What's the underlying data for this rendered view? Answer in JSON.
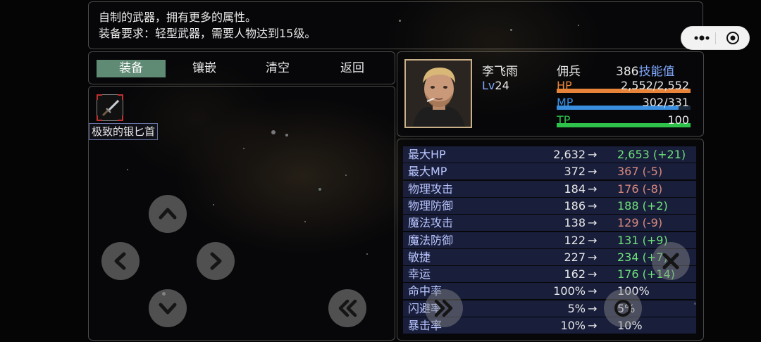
{
  "item_description": {
    "line1": "自制的武器，拥有更多的属性。",
    "line2": "装备要求：轻型武器，需要人物达到15级。"
  },
  "tabs": [
    {
      "label": "装备",
      "active": true
    },
    {
      "label": "镶嵌",
      "active": false
    },
    {
      "label": "清空",
      "active": false
    },
    {
      "label": "返回",
      "active": false
    }
  ],
  "inventory": {
    "selected_item": {
      "name": "极致的银匕首",
      "icon": "dagger-icon"
    }
  },
  "character": {
    "name": "李飞雨",
    "class": "佣兵",
    "level_prefix": "Lv",
    "level": "24",
    "skill_points": "386",
    "skill_points_label": "技能值",
    "hp_label": "HP",
    "hp_value": "2,552/2,552",
    "hp_fraction": 1.0,
    "mp_label": "MP",
    "mp_value": "302/331",
    "mp_fraction": 0.91,
    "tp_label": "TP",
    "tp_value": "100",
    "tp_fraction": 1.0
  },
  "stats": [
    {
      "name": "最大HP",
      "current": "2,632",
      "arrow": "→",
      "new": "2,653 (+21)",
      "trend": "up"
    },
    {
      "name": "最大MP",
      "current": "372",
      "arrow": "→",
      "new": "367 (-5)",
      "trend": "down"
    },
    {
      "name": "物理攻击",
      "current": "184",
      "arrow": "→",
      "new": "176 (-8)",
      "trend": "down"
    },
    {
      "name": "物理防御",
      "current": "186",
      "arrow": "→",
      "new": "188 (+2)",
      "trend": "up"
    },
    {
      "name": "魔法攻击",
      "current": "138",
      "arrow": "→",
      "new": "129 (-9)",
      "trend": "down"
    },
    {
      "name": "魔法防御",
      "current": "122",
      "arrow": "→",
      "new": "131 (+9)",
      "trend": "up"
    },
    {
      "name": "敏捷",
      "current": "227",
      "arrow": "→",
      "new": "234 (+7)",
      "trend": "up"
    },
    {
      "name": "幸运",
      "current": "162",
      "arrow": "→",
      "new": "176 (+14)",
      "trend": "up"
    },
    {
      "name": "命中率",
      "current": "100%",
      "arrow": "→",
      "new": "100%",
      "trend": "same"
    },
    {
      "name": "闪避率",
      "current": "5%",
      "arrow": "→",
      "new": "5%",
      "trend": "same"
    },
    {
      "name": "暴击率",
      "current": "10%",
      "arrow": "→",
      "new": "10%",
      "trend": "same"
    }
  ],
  "controls": {
    "up": "chevron-up-icon",
    "down": "chevron-down-icon",
    "left": "chevron-left-icon",
    "right": "chevron-right-icon",
    "back": "double-chevron-left-icon",
    "forward": "double-chevron-right-icon",
    "close": "close-icon"
  },
  "colors": {
    "hp_bar": "#e8843a",
    "mp_bar": "#3a8ee0",
    "tp_bar": "#2ec24a",
    "tab_active": "#5f8a74",
    "stat_up": "#6ee27a",
    "stat_down": "#d98a7e",
    "skill_label": "#7fa8ff",
    "stat_name": "#b9c6ff"
  }
}
